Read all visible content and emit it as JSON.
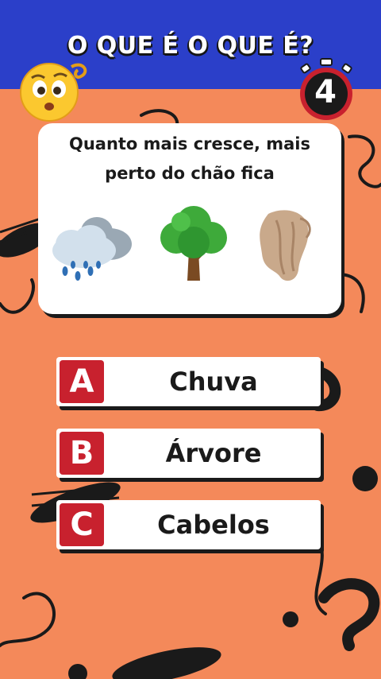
{
  "header": {
    "title": "O QUE É O QUE É?"
  },
  "timer": {
    "value": "4"
  },
  "question": {
    "text": "Quanto mais cresce, mais\nperto do chão fica"
  },
  "pictures": [
    {
      "icon": "rain-cloud-icon"
    },
    {
      "icon": "tree-icon"
    },
    {
      "icon": "hair-icon"
    }
  ],
  "answers": [
    {
      "letter": "A",
      "text": "Chuva"
    },
    {
      "letter": "B",
      "text": "Árvore"
    },
    {
      "letter": "C",
      "text": "Cabelos"
    }
  ],
  "colors": {
    "background": "#f4895a",
    "header": "#2b3fc9",
    "badge": "#c8212e",
    "card": "#ffffff",
    "outline": "#1a1a1a"
  }
}
